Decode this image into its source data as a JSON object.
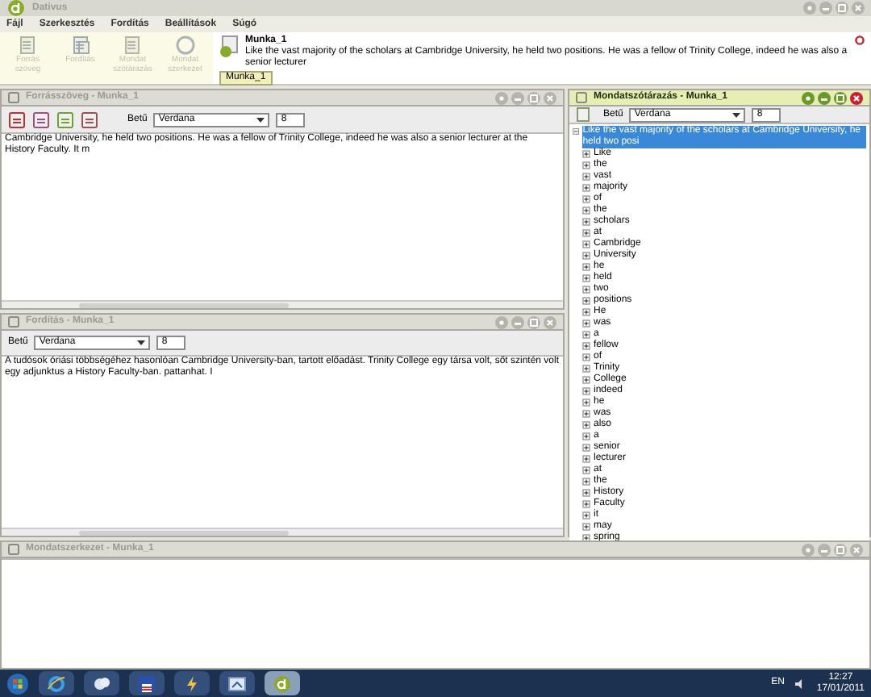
{
  "window": {
    "title": "Dativus"
  },
  "menu": [
    "Fájl",
    "Szerkesztés",
    "Fordítás",
    "Beállítások",
    "Súgó"
  ],
  "toolbar": [
    {
      "label": "Forrás szöveg",
      "kind": "source",
      "disabled": true
    },
    {
      "label": "Fordítás",
      "kind": "translate",
      "disabled": true
    },
    {
      "label": "Mondat szótárazás",
      "kind": "dictionary",
      "disabled": true
    },
    {
      "label": "Mondat szerkezet",
      "kind": "structure",
      "disabled": true
    }
  ],
  "document": {
    "title": "Munka_1",
    "text": "Like the vast majority of the scholars at Cambridge University, he held two positions. He was a fellow of Trinity College,  indeed he was also a senior lecturer",
    "tab": "Munka_1"
  },
  "source_panel": {
    "title": "Forrásszöveg - Munka_1",
    "active": false,
    "font_label": "Betű",
    "font": "Verdana",
    "size": "8",
    "text": "Cambridge University, he held two positions. He was a fellow of Trinity College,  indeed he was also a senior lecturer at the History Faculty. It m"
  },
  "translation_panel": {
    "title": "Fordítás - Munka_1",
    "active": false,
    "font_label": "Betű",
    "font": "Verdana",
    "size": "8",
    "text": "A tudósok óriási többségéhez hasonlóan Cambridge University-ban, tartott előadást. Trinity College egy társa volt, sőt szintén volt egy adjunktus a History Faculty-ban. pattanhat. I"
  },
  "dictionary_panel": {
    "title": "Mondatszótárazás - Munka_1",
    "active": true,
    "font_label": "Betű",
    "font": "Verdana",
    "size": "8",
    "tree": {
      "label": "Like the vast majority of the scholars at Cambridge University, he held two posi",
      "expanded": true,
      "selected": true,
      "children": [
        {
          "label": "Like",
          "expanded": false
        },
        {
          "label": "the",
          "expanded": false
        },
        {
          "label": "vast",
          "expanded": false
        },
        {
          "label": "majority",
          "expanded": false
        },
        {
          "label": "of",
          "expanded": false
        },
        {
          "label": "the",
          "expanded": false
        },
        {
          "label": "scholars",
          "expanded": false
        },
        {
          "label": "at",
          "expanded": false
        },
        {
          "label": "Cambridge",
          "expanded": false
        },
        {
          "label": "University",
          "expanded": false
        },
        {
          "label": "he",
          "expanded": false
        },
        {
          "label": "held",
          "expanded": false
        },
        {
          "label": "two",
          "expanded": false
        },
        {
          "label": "positions",
          "expanded": false
        },
        {
          "label": "He",
          "expanded": false
        },
        {
          "label": "was",
          "expanded": false
        },
        {
          "label": "a",
          "expanded": false
        },
        {
          "label": "fellow",
          "expanded": false
        },
        {
          "label": "of",
          "expanded": false
        },
        {
          "label": "Trinity",
          "expanded": false
        },
        {
          "label": "College",
          "expanded": false
        },
        {
          "label": "indeed",
          "expanded": false
        },
        {
          "label": "he",
          "expanded": false
        },
        {
          "label": "was",
          "expanded": false
        },
        {
          "label": "also",
          "expanded": false
        },
        {
          "label": "a",
          "expanded": false
        },
        {
          "label": "senior",
          "expanded": false
        },
        {
          "label": "lecturer",
          "expanded": false
        },
        {
          "label": "at",
          "expanded": false
        },
        {
          "label": "the",
          "expanded": false
        },
        {
          "label": "History",
          "expanded": false
        },
        {
          "label": "Faculty",
          "expanded": false
        },
        {
          "label": "it",
          "expanded": false
        },
        {
          "label": "may",
          "expanded": false
        },
        {
          "label": "spring",
          "expanded": false
        }
      ]
    }
  },
  "structure_panel": {
    "title": "Mondatszerkezet - Munka_1",
    "active": false
  },
  "taskbar": {
    "apps": [
      {
        "kind": "browser",
        "selected": false
      },
      {
        "kind": "network",
        "selected": false
      },
      {
        "kind": "floppy",
        "selected": false
      },
      {
        "kind": "lightning",
        "selected": false
      },
      {
        "kind": "window",
        "selected": false
      },
      {
        "kind": "dativus",
        "selected": true
      }
    ],
    "language": "EN",
    "time": "12:27",
    "date": "17/01/2011"
  }
}
